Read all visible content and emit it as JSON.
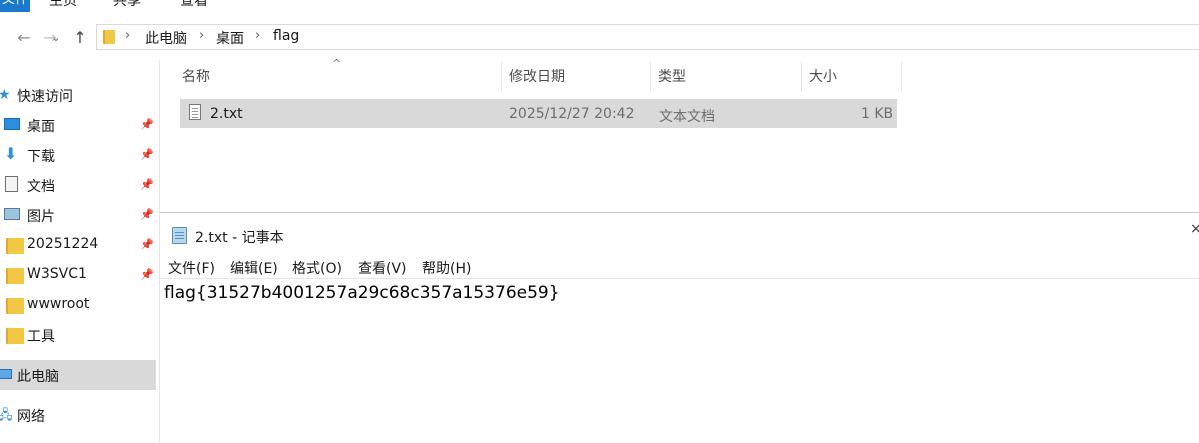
{
  "ribbon": {
    "file_tab": "文件",
    "tabs": [
      "主页",
      "共享",
      "查看"
    ]
  },
  "address_bar": {
    "breadcrumbs": [
      "此电脑",
      "桌面",
      "flag"
    ]
  },
  "sidebar": {
    "quick_access": "快速访问",
    "items": [
      {
        "label": "桌面",
        "icon": "desktop-icon",
        "pinned": true
      },
      {
        "label": "下载",
        "icon": "download-icon",
        "pinned": true
      },
      {
        "label": "文档",
        "icon": "document-icon",
        "pinned": true
      },
      {
        "label": "图片",
        "icon": "picture-icon",
        "pinned": true
      },
      {
        "label": "20251224",
        "icon": "folder-icon",
        "pinned": true
      },
      {
        "label": "W3SVC1",
        "icon": "folder-icon",
        "pinned": true
      },
      {
        "label": "wwwroot",
        "icon": "folder-icon",
        "pinned": false
      },
      {
        "label": "工具",
        "icon": "folder-icon",
        "pinned": false
      }
    ],
    "this_pc": "此电脑",
    "network": "网络"
  },
  "file_list": {
    "columns": [
      "名称",
      "修改日期",
      "类型",
      "大小"
    ],
    "rows": [
      {
        "name": "2.txt",
        "modified": "2025/12/27 20:42",
        "type": "文本文档",
        "size": "1 KB"
      }
    ]
  },
  "notepad": {
    "title": "2.txt - 记事本",
    "menu": [
      "文件(F)",
      "编辑(E)",
      "格式(O)",
      "查看(V)",
      "帮助(H)"
    ],
    "content": "flag{31527b4001257a29c68c357a15376e59}"
  },
  "colors": {
    "accent": "#1979ca",
    "selection": "#d9d9d9",
    "folder": "#f2c744"
  }
}
